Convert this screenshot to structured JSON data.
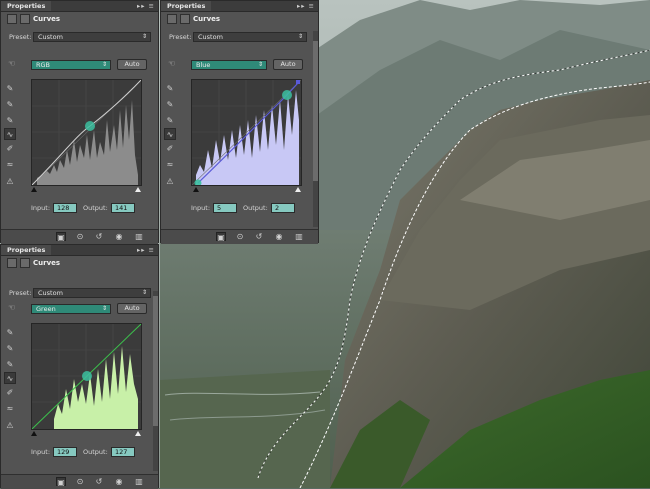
{
  "document": {
    "canvas_label": "document-canvas-mountain-photo"
  },
  "panels": [
    {
      "id": "rgb",
      "tab": "Properties",
      "tab_controls": "▸▸ ≡",
      "title": "Curves",
      "preset_label": "Preset:",
      "preset_value": "Custom",
      "channel": "RGB",
      "auto_label": "Auto",
      "input_label": "Input:",
      "input_value": "128",
      "output_label": "Output:",
      "output_value": "141",
      "curve_color": "#c8c8c8",
      "histogram_color": "#8c8c8c"
    },
    {
      "id": "blue",
      "tab": "Properties",
      "tab_controls": "▸▸ ≡",
      "title": "Curves",
      "preset_label": "Preset:",
      "preset_value": "Custom",
      "channel": "Blue",
      "auto_label": "Auto",
      "input_label": "Input:",
      "input_value": "5",
      "output_label": "Output:",
      "output_value": "2",
      "curve_color": "#5a5ad8",
      "histogram_color": "#c8c8f5"
    },
    {
      "id": "green",
      "tab": "Properties",
      "tab_controls": "▸▸ ≡",
      "title": "Curves",
      "preset_label": "Preset:",
      "preset_value": "Custom",
      "channel": "Green",
      "auto_label": "Auto",
      "input_label": "Input:",
      "input_value": "129",
      "output_label": "Output:",
      "output_value": "127",
      "curve_color": "#3cc04c",
      "histogram_color": "#c8f0a8"
    }
  ],
  "tools": [
    "targeted-adjust-icon",
    "sample-black-point-icon",
    "sample-gray-point-icon",
    "sample-white-point-icon",
    "curve-point-icon",
    "pencil-icon",
    "smooth-icon",
    "clipping-warning-icon"
  ],
  "footer_icons": [
    "clip-to-layer-icon",
    "view-previous-state-icon",
    "reset-icon",
    "visibility-eye-icon",
    "delete-icon"
  ],
  "colors": {
    "panel_bg": "#535353",
    "field_bg": "#86c9c0",
    "channel_select": "#2f8a78"
  }
}
